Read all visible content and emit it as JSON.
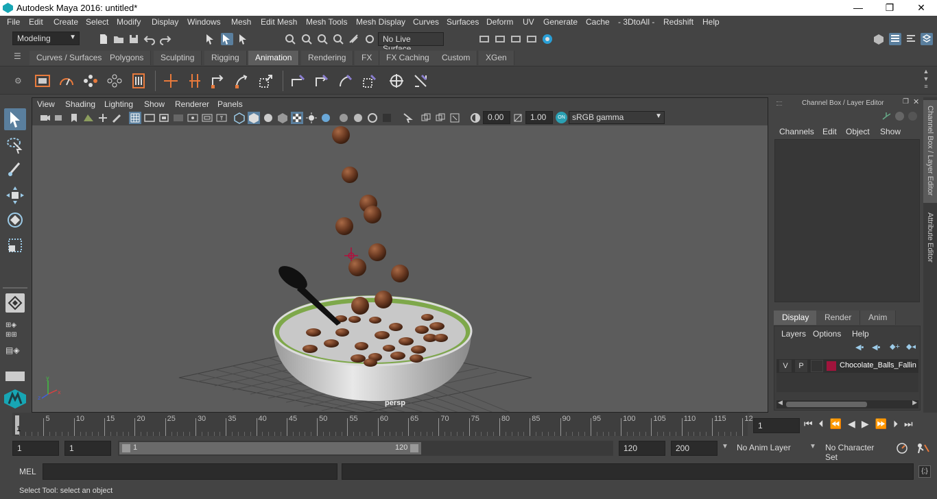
{
  "window": {
    "title": "Autodesk Maya 2016: untitled*",
    "min": "—",
    "max": "❐",
    "close": "✕"
  },
  "menu": [
    "File",
    "Edit",
    "Create",
    "Select",
    "Modify",
    "Display",
    "Windows",
    "Mesh",
    "Edit Mesh",
    "Mesh Tools",
    "Mesh Display",
    "Curves",
    "Surfaces",
    "Deform",
    "UV",
    "Generate",
    "Cache",
    "- 3DtoAll -",
    "Redshift",
    "Help"
  ],
  "status": {
    "mode": "Modeling",
    "live_surface": "No Live Surface"
  },
  "shelf_tabs": [
    "Curves / Surfaces",
    "Polygons",
    "Sculpting",
    "Rigging",
    "Animation",
    "Rendering",
    "FX",
    "FX Caching",
    "Custom",
    "XGen"
  ],
  "shelf_active": "Animation",
  "viewport": {
    "menu": [
      "View",
      "Shading",
      "Lighting",
      "Show",
      "Renderer",
      "Panels"
    ],
    "exposure": "0.00",
    "gamma": "1.00",
    "color_space": "sRGB gamma",
    "camera_label": "persp"
  },
  "channel_box": {
    "title": "Channel Box / Layer Editor",
    "menu": [
      "Channels",
      "Edit",
      "Object",
      "Show"
    ]
  },
  "layer_editor": {
    "tabs": [
      "Display",
      "Render",
      "Anim"
    ],
    "active_tab": "Display",
    "menu": [
      "Layers",
      "Options",
      "Help"
    ],
    "layer": {
      "v": "V",
      "p": "P",
      "name": "Chocolate_Balls_Fallin",
      "color": "#a0143c"
    }
  },
  "side_tabs": [
    "Channel Box / Layer Editor",
    "Attribute Editor"
  ],
  "timeline": {
    "ticks": [
      "5",
      "10",
      "15",
      "20",
      "25",
      "30",
      "35",
      "40",
      "45",
      "50",
      "55",
      "60",
      "65",
      "70",
      "75",
      "80",
      "85",
      "90",
      "95",
      "100",
      "105",
      "110",
      "115",
      "12"
    ],
    "current_marker": "1",
    "current_frame": "1"
  },
  "range": {
    "start": "1",
    "anim_start": "1",
    "slider_start": "1",
    "slider_end": "120",
    "end": "120",
    "anim_end": "200",
    "anim_layer": "No Anim Layer",
    "char_set": "No Character Set"
  },
  "cmd": {
    "label": "MEL"
  },
  "help": {
    "text": "Select Tool: select an object"
  },
  "colors": {
    "accent": "#5d5d5d",
    "bowl_rim": "#7ea84a",
    "milk": "#cfcfcf",
    "ball": "#6b3a22",
    "spoon": "#111111"
  }
}
